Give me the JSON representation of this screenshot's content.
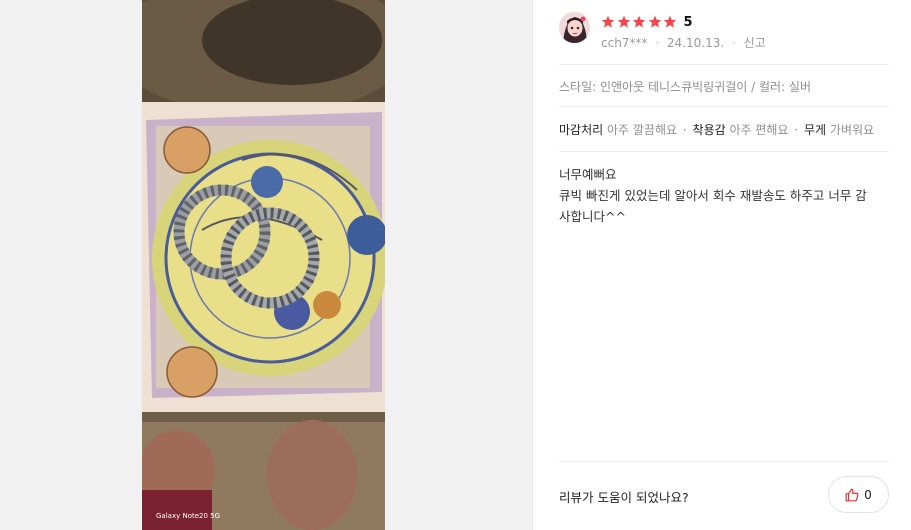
{
  "review": {
    "rating": "5",
    "rating_value": 5,
    "rating_max": 5,
    "star_color": "#f8434c",
    "author": "cch7***",
    "date": "24.10.13.",
    "report_label": "신고",
    "style_line": "스타일: 인앤아웃 테니스큐빅링귀걸이 / 컬러: 실버",
    "attributes": [
      {
        "key": "마감처리",
        "value": "아주 깔끔해요"
      },
      {
        "key": "착용감",
        "value": "아주 편해요"
      },
      {
        "key": "무게",
        "value": "가벼워요"
      }
    ],
    "body_lines": [
      "너무예뻐요",
      "큐빅 빠진게 있었는데 알아서 회수 재발송도 하주고 너무 감",
      "사합니다^^"
    ]
  },
  "photo": {
    "caption": "Galaxy Note20 5G"
  },
  "helpful": {
    "question": "리뷰가 도움이 되었나요?",
    "count": "0"
  },
  "icons": {
    "star": "star-icon",
    "thumbs_up": "thumbs-up-icon"
  }
}
